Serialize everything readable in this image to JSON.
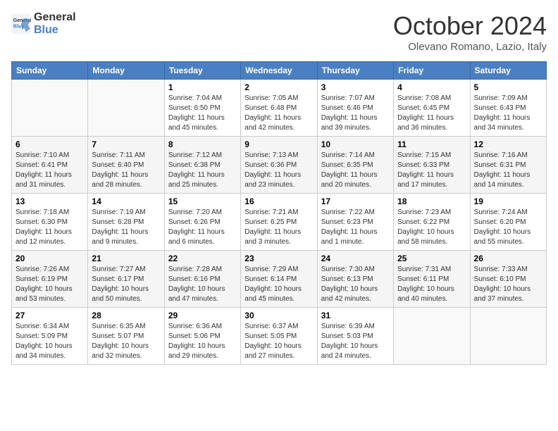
{
  "header": {
    "logo_line1": "General",
    "logo_line2": "Blue",
    "month": "October 2024",
    "location": "Olevano Romano, Lazio, Italy"
  },
  "columns": [
    "Sunday",
    "Monday",
    "Tuesday",
    "Wednesday",
    "Thursday",
    "Friday",
    "Saturday"
  ],
  "weeks": [
    [
      {
        "day": "",
        "info": ""
      },
      {
        "day": "",
        "info": ""
      },
      {
        "day": "1",
        "info": "Sunrise: 7:04 AM\nSunset: 6:50 PM\nDaylight: 11 hours and 45 minutes."
      },
      {
        "day": "2",
        "info": "Sunrise: 7:05 AM\nSunset: 6:48 PM\nDaylight: 11 hours and 42 minutes."
      },
      {
        "day": "3",
        "info": "Sunrise: 7:07 AM\nSunset: 6:46 PM\nDaylight: 11 hours and 39 minutes."
      },
      {
        "day": "4",
        "info": "Sunrise: 7:08 AM\nSunset: 6:45 PM\nDaylight: 11 hours and 36 minutes."
      },
      {
        "day": "5",
        "info": "Sunrise: 7:09 AM\nSunset: 6:43 PM\nDaylight: 11 hours and 34 minutes."
      }
    ],
    [
      {
        "day": "6",
        "info": "Sunrise: 7:10 AM\nSunset: 6:41 PM\nDaylight: 11 hours and 31 minutes."
      },
      {
        "day": "7",
        "info": "Sunrise: 7:11 AM\nSunset: 6:40 PM\nDaylight: 11 hours and 28 minutes."
      },
      {
        "day": "8",
        "info": "Sunrise: 7:12 AM\nSunset: 6:38 PM\nDaylight: 11 hours and 25 minutes."
      },
      {
        "day": "9",
        "info": "Sunrise: 7:13 AM\nSunset: 6:36 PM\nDaylight: 11 hours and 23 minutes."
      },
      {
        "day": "10",
        "info": "Sunrise: 7:14 AM\nSunset: 6:35 PM\nDaylight: 11 hours and 20 minutes."
      },
      {
        "day": "11",
        "info": "Sunrise: 7:15 AM\nSunset: 6:33 PM\nDaylight: 11 hours and 17 minutes."
      },
      {
        "day": "12",
        "info": "Sunrise: 7:16 AM\nSunset: 6:31 PM\nDaylight: 11 hours and 14 minutes."
      }
    ],
    [
      {
        "day": "13",
        "info": "Sunrise: 7:18 AM\nSunset: 6:30 PM\nDaylight: 11 hours and 12 minutes."
      },
      {
        "day": "14",
        "info": "Sunrise: 7:19 AM\nSunset: 6:28 PM\nDaylight: 11 hours and 9 minutes."
      },
      {
        "day": "15",
        "info": "Sunrise: 7:20 AM\nSunset: 6:26 PM\nDaylight: 11 hours and 6 minutes."
      },
      {
        "day": "16",
        "info": "Sunrise: 7:21 AM\nSunset: 6:25 PM\nDaylight: 11 hours and 3 minutes."
      },
      {
        "day": "17",
        "info": "Sunrise: 7:22 AM\nSunset: 6:23 PM\nDaylight: 11 hours and 1 minute."
      },
      {
        "day": "18",
        "info": "Sunrise: 7:23 AM\nSunset: 6:22 PM\nDaylight: 10 hours and 58 minutes."
      },
      {
        "day": "19",
        "info": "Sunrise: 7:24 AM\nSunset: 6:20 PM\nDaylight: 10 hours and 55 minutes."
      }
    ],
    [
      {
        "day": "20",
        "info": "Sunrise: 7:26 AM\nSunset: 6:19 PM\nDaylight: 10 hours and 53 minutes."
      },
      {
        "day": "21",
        "info": "Sunrise: 7:27 AM\nSunset: 6:17 PM\nDaylight: 10 hours and 50 minutes."
      },
      {
        "day": "22",
        "info": "Sunrise: 7:28 AM\nSunset: 6:16 PM\nDaylight: 10 hours and 47 minutes."
      },
      {
        "day": "23",
        "info": "Sunrise: 7:29 AM\nSunset: 6:14 PM\nDaylight: 10 hours and 45 minutes."
      },
      {
        "day": "24",
        "info": "Sunrise: 7:30 AM\nSunset: 6:13 PM\nDaylight: 10 hours and 42 minutes."
      },
      {
        "day": "25",
        "info": "Sunrise: 7:31 AM\nSunset: 6:11 PM\nDaylight: 10 hours and 40 minutes."
      },
      {
        "day": "26",
        "info": "Sunrise: 7:33 AM\nSunset: 6:10 PM\nDaylight: 10 hours and 37 minutes."
      }
    ],
    [
      {
        "day": "27",
        "info": "Sunrise: 6:34 AM\nSunset: 5:09 PM\nDaylight: 10 hours and 34 minutes."
      },
      {
        "day": "28",
        "info": "Sunrise: 6:35 AM\nSunset: 5:07 PM\nDaylight: 10 hours and 32 minutes."
      },
      {
        "day": "29",
        "info": "Sunrise: 6:36 AM\nSunset: 5:06 PM\nDaylight: 10 hours and 29 minutes."
      },
      {
        "day": "30",
        "info": "Sunrise: 6:37 AM\nSunset: 5:05 PM\nDaylight: 10 hours and 27 minutes."
      },
      {
        "day": "31",
        "info": "Sunrise: 6:39 AM\nSunset: 5:03 PM\nDaylight: 10 hours and 24 minutes."
      },
      {
        "day": "",
        "info": ""
      },
      {
        "day": "",
        "info": ""
      }
    ]
  ]
}
